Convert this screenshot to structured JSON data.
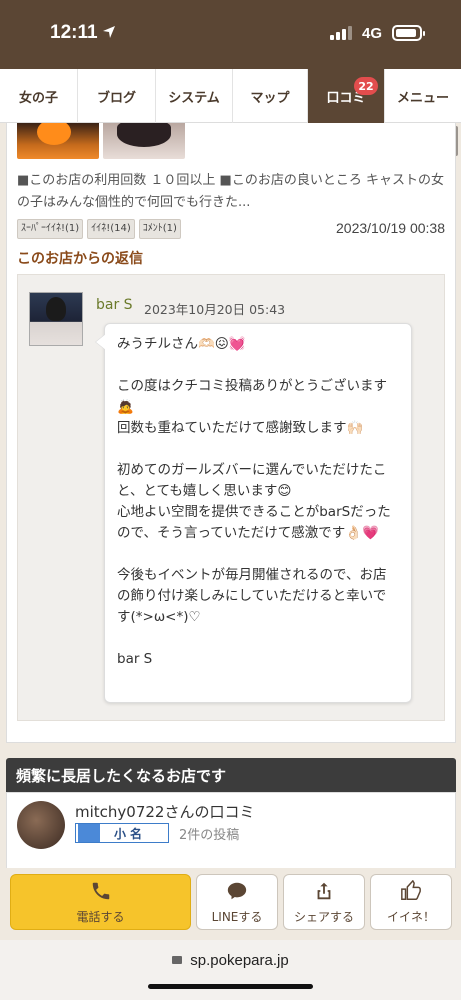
{
  "status": {
    "time": "12:11",
    "network": "4G"
  },
  "nav": {
    "tabs": [
      {
        "label": "女の子"
      },
      {
        "label": "ブログ"
      },
      {
        "label": "システム"
      },
      {
        "label": "マップ"
      },
      {
        "label": "口コミ",
        "badge": "22"
      },
      {
        "label": "メニュー"
      }
    ]
  },
  "review": {
    "text": "■このお店の利用回数 １０回以上 ■このお店の良いところ キャストの女の子はみんな個性的で何回でも行きた...",
    "tags": [
      "ｽｰﾊﾟｰｲｲﾈ!(1)",
      "ｲｲﾈ!(14)",
      "ｺﾒﾝﾄ(1)"
    ],
    "date": "2023/10/19 00:38"
  },
  "reply": {
    "heading": "このお店からの返信",
    "name": "bar S",
    "date": "2023年10月20日 05:43",
    "message": "みうチルさん🫶🏻😖💓\n\nこの度はクチコミ投稿ありがとうございます🙇\n回数も重ねていただけて感謝致します🙌🏻\n\n初めてのガールズバーに選んでいただけたこと、とても嬉しく思います😊\n心地よい空間を提供できることがbarSだったので、そう言っていただけて感激です👌🏻💗\n\n今後もイベントが毎月開催されるので、お店の飾り付け楽しみにしていただけると幸いです(*&gt;ω&lt;*)♡\n\nbar S"
  },
  "second_review": {
    "title": "頻繁に長居したくなるお店です",
    "reviewer": "mitchy0722さんの口コミ",
    "rank": "小名",
    "posts": "2件の投稿"
  },
  "actions": {
    "call": "電話する",
    "line": "LINEする",
    "share": "シェアする",
    "like": "イイネ！"
  },
  "browser": {
    "url": "sp.pokepara.jp"
  },
  "colors": {
    "brand_brown": "#5b4634",
    "call_yellow": "#f6c42b",
    "badge_red": "#e24d4d"
  }
}
